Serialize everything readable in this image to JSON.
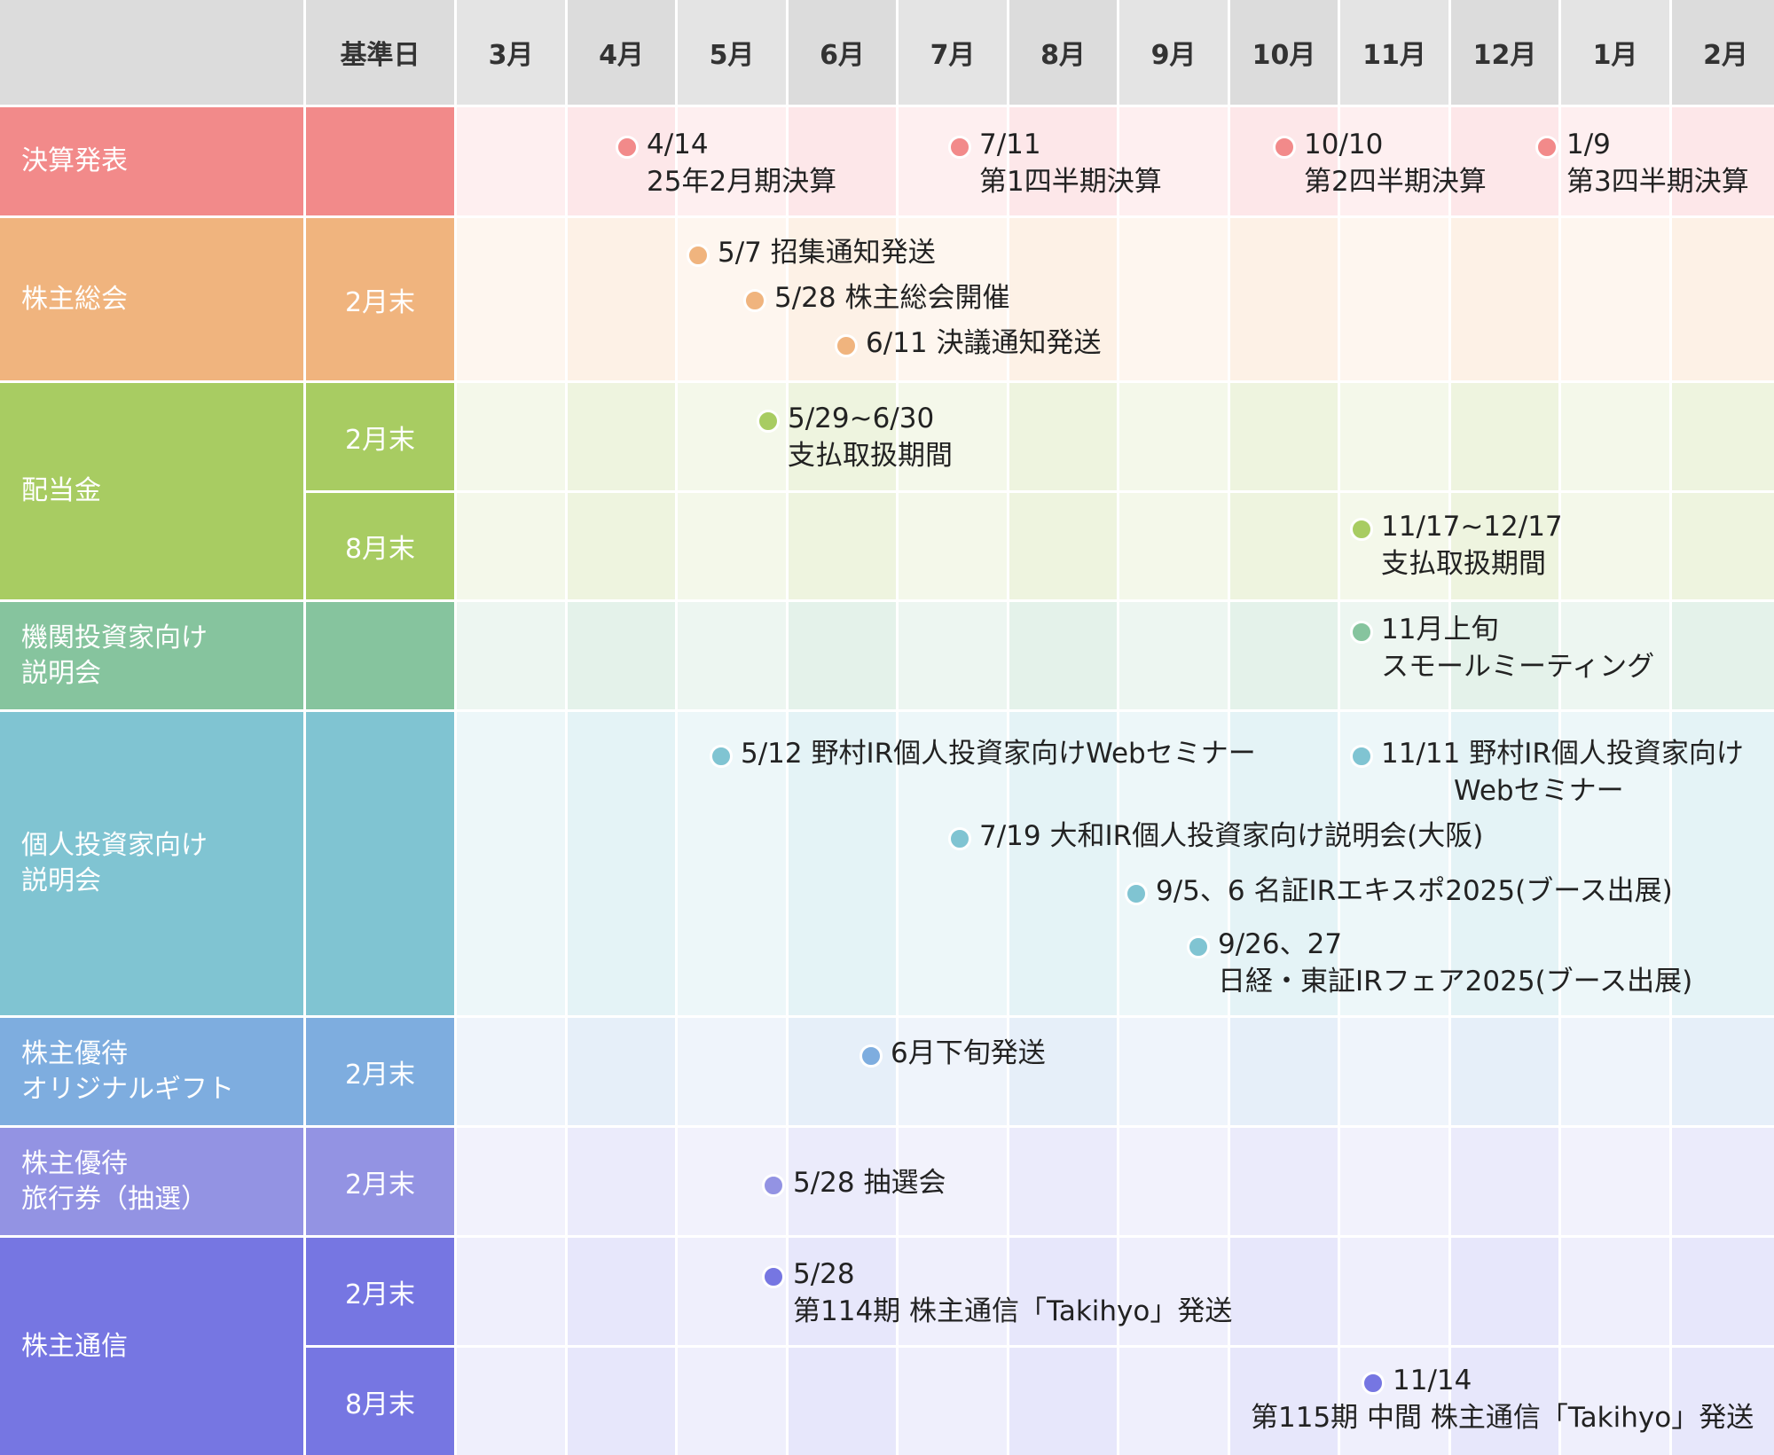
{
  "header": {
    "kijunbi": "基準日",
    "months": [
      "3月",
      "4月",
      "5月",
      "6月",
      "7月",
      "8月",
      "9月",
      "10月",
      "11月",
      "12月",
      "1月",
      "2月"
    ]
  },
  "rows": {
    "kessan": {
      "label": "決算発表",
      "kijun": ""
    },
    "soukai": {
      "label": "株主総会",
      "kijun": "2月末"
    },
    "haitou": {
      "label": "配当金",
      "kijun_a": "2月末",
      "kijun_b": "8月末"
    },
    "kikan": {
      "label": "機関投資家向け\n説明会",
      "kijun": ""
    },
    "kojin": {
      "label": "個人投資家向け\n説明会",
      "kijun": ""
    },
    "yutai_gift": {
      "label": "株主優待\nオリジナルギフト",
      "kijun": "2月末"
    },
    "yutai_ryokou": {
      "label": "株主優待\n旅行券（抽選）",
      "kijun": "2月末"
    },
    "tsushin": {
      "label": "株主通信",
      "kijun_a": "2月末",
      "kijun_b": "8月末"
    }
  },
  "events": {
    "k1": {
      "line1": "4/14",
      "line2": "25年2月期決算"
    },
    "k2": {
      "line1": "7/11",
      "line2": "第1四半期決算"
    },
    "k3": {
      "line1": "10/10",
      "line2": "第2四半期決算"
    },
    "k4": {
      "line1": "1/9",
      "line2": "第3四半期決算"
    },
    "s1": {
      "line1": "5/7 招集通知発送"
    },
    "s2": {
      "line1": "5/28 株主総会開催"
    },
    "s3": {
      "line1": "6/11 決議通知発送"
    },
    "h1": {
      "line1": "5/29~6/30",
      "line2": "支払取扱期間"
    },
    "h2": {
      "line1": "11/17~12/17",
      "line2": "支払取扱期間"
    },
    "m1": {
      "line1": "11月上旬",
      "line2": "スモールミーティング"
    },
    "p1": {
      "line1": "5/12 野村IR個人投資家向けWebセミナー"
    },
    "p2": {
      "line1": "11/11 野村IR個人投資家向け",
      "line2": "Webセミナー"
    },
    "p3": {
      "line1": "7/19 大和IR個人投資家向け説明会(大阪)"
    },
    "p4": {
      "line1": "9/5、6 名証IRエキスポ2025(ブース出展)"
    },
    "p5": {
      "line1": "9/26、27",
      "line2": "日経・東証IRフェア2025(ブース出展)"
    },
    "g1": {
      "line1": "6月下旬発送"
    },
    "r1": {
      "line1": "5/28 抽選会"
    },
    "t1": {
      "line1": "5/28",
      "line2": "第114期 株主通信「Takihyo」発送"
    },
    "t2": {
      "line1": "11/14",
      "line2": "第115期 中間 株主通信「Takihyo」発送"
    }
  },
  "colors": {
    "header_bg": "#dcdcdc",
    "kessan": "#f28a8a",
    "kessan_bg": "#fde7e9",
    "soukai": "#f0b47e",
    "soukai_bg": "#fdf1e6",
    "haitou": "#a8cc62",
    "haitou_bg": "#eef4df",
    "kikan": "#86c49e",
    "kikan_bg": "#e4f2ea",
    "kojin": "#80c4d2",
    "kojin_bg": "#e4f3f6",
    "gift": "#7eaddf",
    "gift_bg": "#e6eff9",
    "ryokou": "#9393e3",
    "ryokou_bg": "#ebebfb",
    "tsushin": "#7676e2",
    "tsushin_bg": "#e7e7fb"
  }
}
